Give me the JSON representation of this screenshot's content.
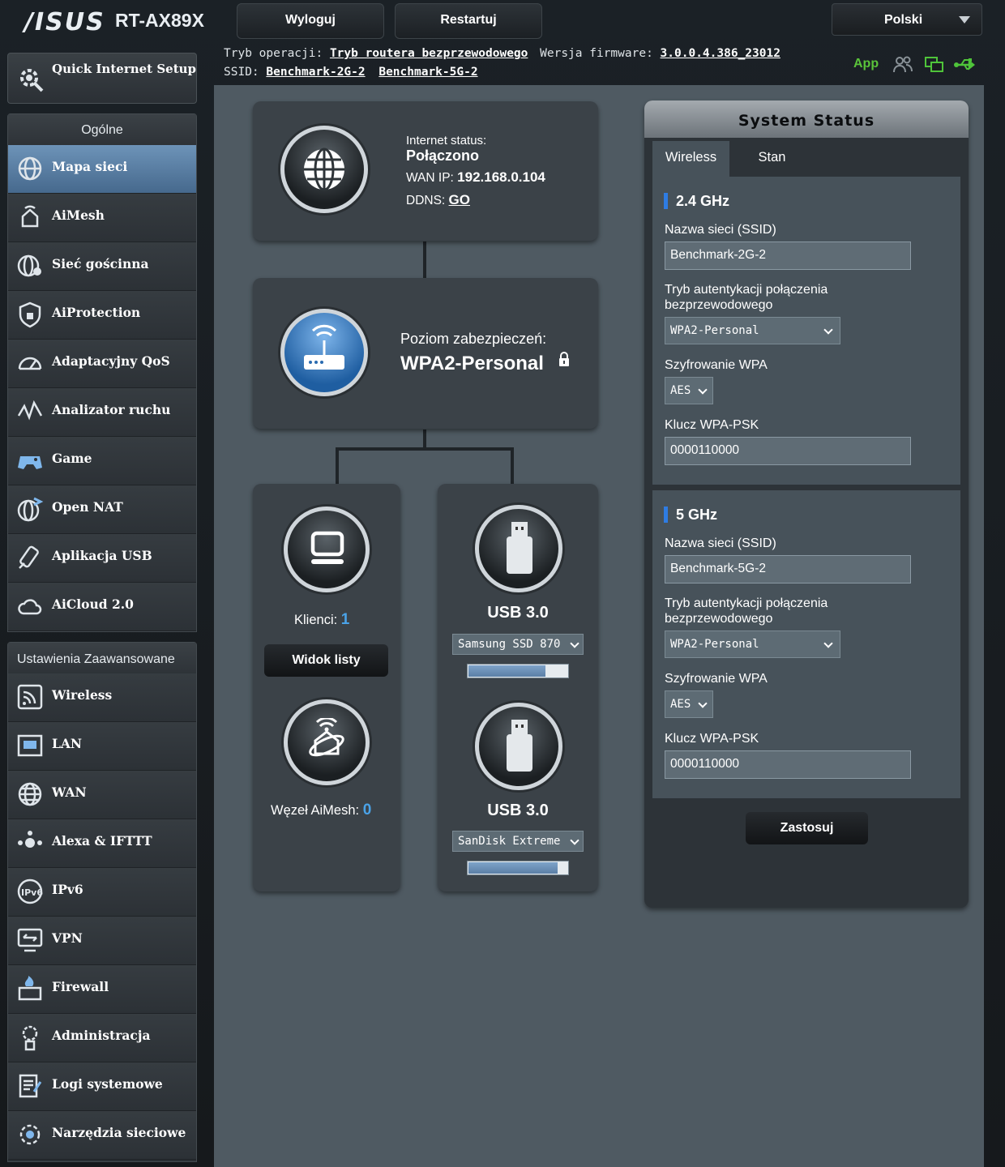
{
  "header": {
    "brand": "/ISUS",
    "model": "RT-AX89X",
    "logout_label": "Wyloguj",
    "restart_label": "Restartuj",
    "language": "Polski",
    "mode_label": "Tryb operacji:",
    "mode_value": "Tryb routera bezprzewodowego",
    "firmware_label": "Wersja firmware:",
    "firmware_value": "3.0.0.4.386_23012",
    "ssid_label": "SSID:",
    "ssid_2g": "Benchmark-2G-2",
    "ssid_5g": "Benchmark-5G-2",
    "app_label": "App"
  },
  "sidebar": {
    "quick_setup": "Quick Internet Setup",
    "general_title": "Ogólne",
    "general_items": [
      {
        "label": "Mapa sieci",
        "icon": "network-map-icon"
      },
      {
        "label": "AiMesh",
        "icon": "aimesh-icon"
      },
      {
        "label": "Sieć gościnna",
        "icon": "guest-network-icon"
      },
      {
        "label": "AiProtection",
        "icon": "aiprotection-icon"
      },
      {
        "label": "Adaptacyjny QoS",
        "icon": "qos-icon"
      },
      {
        "label": "Analizator ruchu",
        "icon": "traffic-analyzer-icon"
      },
      {
        "label": "Game",
        "icon": "gamepad-icon"
      },
      {
        "label": "Open NAT",
        "icon": "open-nat-icon"
      },
      {
        "label": "Aplikacja USB",
        "icon": "usb-app-icon"
      },
      {
        "label": "AiCloud 2.0",
        "icon": "aicloud-icon"
      }
    ],
    "advanced_title": "Ustawienia Zaawansowane",
    "advanced_items": [
      {
        "label": "Wireless",
        "icon": "wireless-icon"
      },
      {
        "label": "LAN",
        "icon": "lan-icon"
      },
      {
        "label": "WAN",
        "icon": "wan-icon"
      },
      {
        "label": "Alexa & IFTTT",
        "icon": "alexa-icon"
      },
      {
        "label": "IPv6",
        "icon": "ipv6-icon"
      },
      {
        "label": "VPN",
        "icon": "vpn-icon"
      },
      {
        "label": "Firewall",
        "icon": "firewall-icon"
      },
      {
        "label": "Administracja",
        "icon": "administration-icon"
      },
      {
        "label": "Logi systemowe",
        "icon": "system-log-icon"
      },
      {
        "label": "Narzędzia sieciowe",
        "icon": "network-tools-icon"
      }
    ]
  },
  "map": {
    "internet_status_label": "Internet status:",
    "internet_status_value": "Połączono",
    "wan_ip_label": "WAN IP:",
    "wan_ip_value": "192.168.0.104",
    "ddns_label": "DDNS:",
    "ddns_value": "GO",
    "security_label": "Poziom zabezpieczeń:",
    "security_value": "WPA2-Personal",
    "clients_label": "Klienci:",
    "clients_value": "1",
    "list_view_label": "Widok listy",
    "aimesh_label": "Węzeł AiMesh:",
    "aimesh_value": "0",
    "usb1_title": "USB 3.0",
    "usb1_device": "Samsung SSD 870",
    "usb1_fill": 0.78,
    "usb2_title": "USB 3.0",
    "usb2_device": "SanDisk Extreme",
    "usb2_fill": 0.9
  },
  "status": {
    "title": "System Status",
    "tab_wireless": "Wireless",
    "tab_stan": "Stan",
    "band_24": "2.4 GHz",
    "band_5": "5 GHz",
    "ssid_label": "Nazwa sieci (SSID)",
    "auth_label": "Tryb autentykacji połączenia bezprzewodowego",
    "enc_label": "Szyfrowanie WPA",
    "key_label": "Klucz WPA-PSK",
    "ssid_24": "Benchmark-2G-2",
    "auth_24": "WPA2-Personal",
    "enc_24": "AES",
    "key_24": "0000110000",
    "ssid_5": "Benchmark-5G-2",
    "auth_5": "WPA2-Personal",
    "enc_5": "AES",
    "key_5": "0000110000",
    "apply_label": "Zastosuj"
  }
}
